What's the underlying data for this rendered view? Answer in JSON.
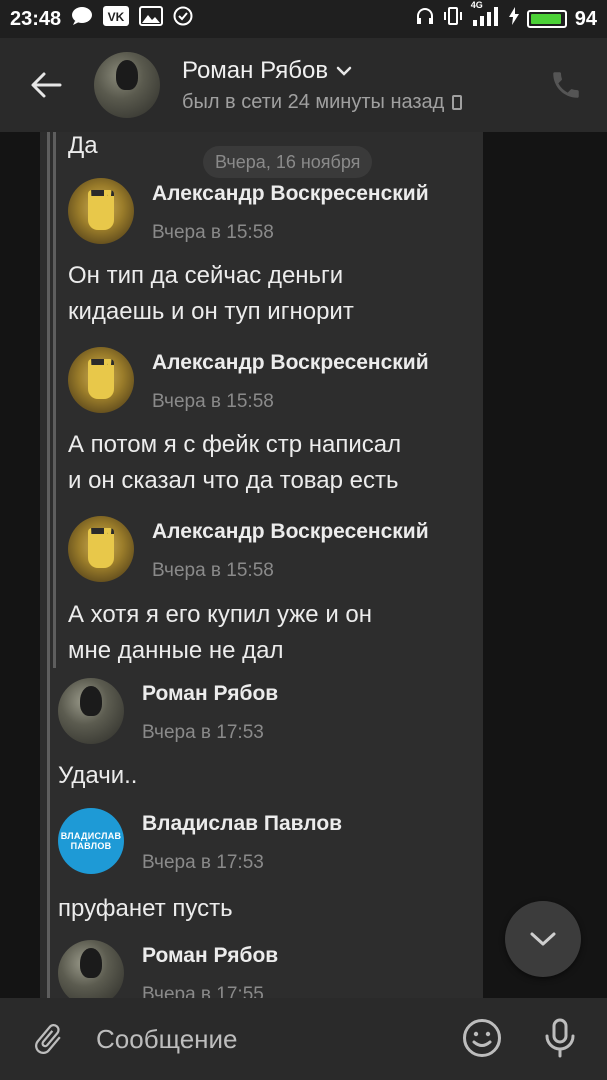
{
  "status_bar": {
    "time": "23:48",
    "network": "4G",
    "battery": "94",
    "battery_level": 0.94
  },
  "header": {
    "name": "Роман Рябов",
    "status": "был в сети 24 минуты назад",
    "icons": [
      "back-arrow-icon",
      "chevron-down-icon",
      "phone-icon",
      "call-icon"
    ]
  },
  "chat": {
    "date_separator": "Вчера, 16 ноября",
    "top_text": "Да",
    "forwarded": [
      {
        "author": "Александр Воскресенский",
        "time": "Вчера в 15:58",
        "text": "Он тип да сейчас  деньги\nкидаешь и он туп игнорит"
      },
      {
        "author": "Александр Воскресенский",
        "time": "Вчера в 15:58",
        "text": "А потом  я с фейк стр написал\nи он сказал что да товар есть"
      },
      {
        "author": "Александр Воскресенский",
        "time": "Вчера в 15:58",
        "text": "А хотя я его купил уже и он\nмне данные не дал"
      }
    ],
    "outer": [
      {
        "author": "Роман Рябов",
        "time": "Вчера в 17:53",
        "text": "Удачи.."
      },
      {
        "author": "Владислав Павлов",
        "time": "Вчера в 17:53",
        "text": "пруфанет пусть",
        "avatar_text": "ВЛАДИСЛАВ ПАВЛОВ"
      },
      {
        "author": "Роман Рябов",
        "time": "Вчера в 17:55",
        "text": ""
      }
    ]
  },
  "composer": {
    "placeholder": "Сообщение",
    "icons": [
      "attach-icon",
      "emoji-icon",
      "mic-icon"
    ]
  },
  "colors": {
    "background": "#141414",
    "panel": "#2d2d2d",
    "header": "#2a2a2a",
    "accent_green": "#4cd137",
    "vk_blue": "#1e9ad6"
  }
}
